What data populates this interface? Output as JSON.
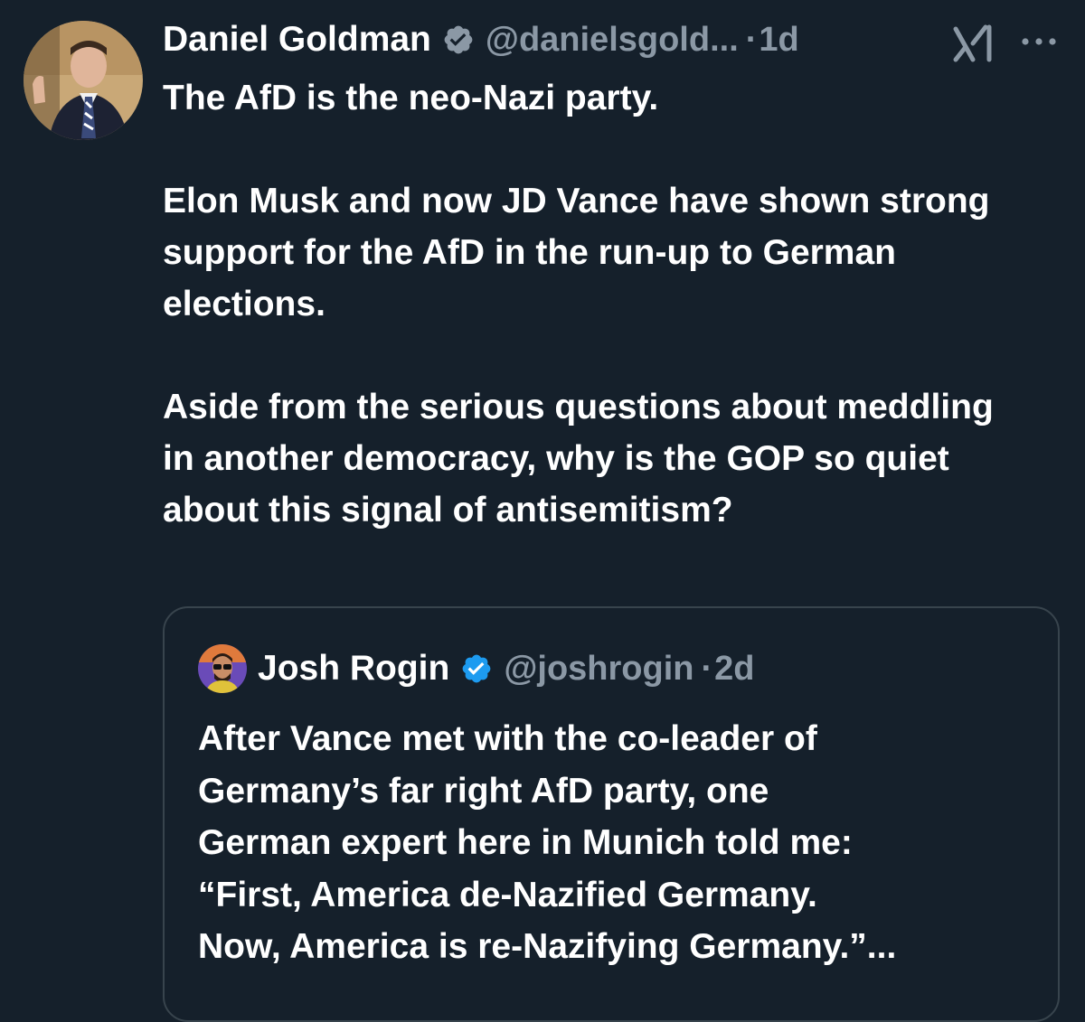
{
  "tweet": {
    "author": {
      "display_name": "Daniel Goldman",
      "handle": "@danielsgold...",
      "separator": "·",
      "time": "1d",
      "avatar_icon": "profile-photo",
      "verified_icon": "verified-badge-icon"
    },
    "header_icons": [
      "grok-icon",
      "more-options-icon"
    ],
    "body": {
      "paragraphs": [
        "The AfD is the neo-Nazi party.",
        "Elon Musk and now JD Vance have shown strong support for the AfD in the run-up to German elections.",
        "Aside from the serious questions about meddling in another democracy, why is the GOP so quiet about this signal of antisemitism?"
      ]
    },
    "quoted": {
      "display_name": "Josh Rogin",
      "handle": "@joshrogin",
      "separator": "·",
      "time": "2d",
      "lines": [
        "After Vance met with the co-leader of",
        "Germany’s far right AfD party, one",
        "German expert here in Munich told me:",
        "“First, America de-Nazified Germany.",
        "Now, America is re-Nazifying Germany.”..."
      ]
    }
  },
  "colors": {
    "background": "#15202b",
    "text": "#ffffff",
    "muted": "#8b98a5",
    "border": "#38444d",
    "verified": "#8b98a5",
    "quote_verified": "#1d9bf0"
  }
}
